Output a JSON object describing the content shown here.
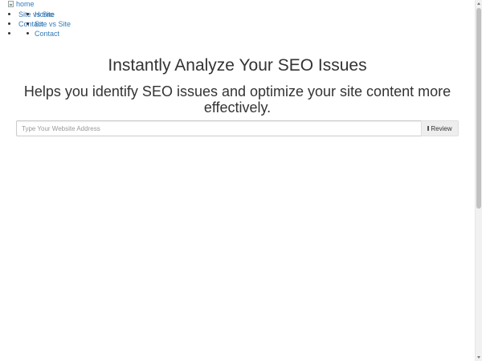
{
  "nav": {
    "logo_alt": "home",
    "primary": [
      "Site vs Site",
      "Contact"
    ],
    "secondary": [
      "Home",
      "Site vs Site",
      "Contact"
    ]
  },
  "hero": {
    "title": "Instantly Analyze Your SEO Issues",
    "subtitle": "Helps you identify SEO issues and optimize your site content more effectively."
  },
  "search": {
    "placeholder": "Type Your Website Address",
    "button_label": "Review"
  },
  "icons": {
    "logo": "broken-image-icon",
    "review": "refresh-icon"
  }
}
